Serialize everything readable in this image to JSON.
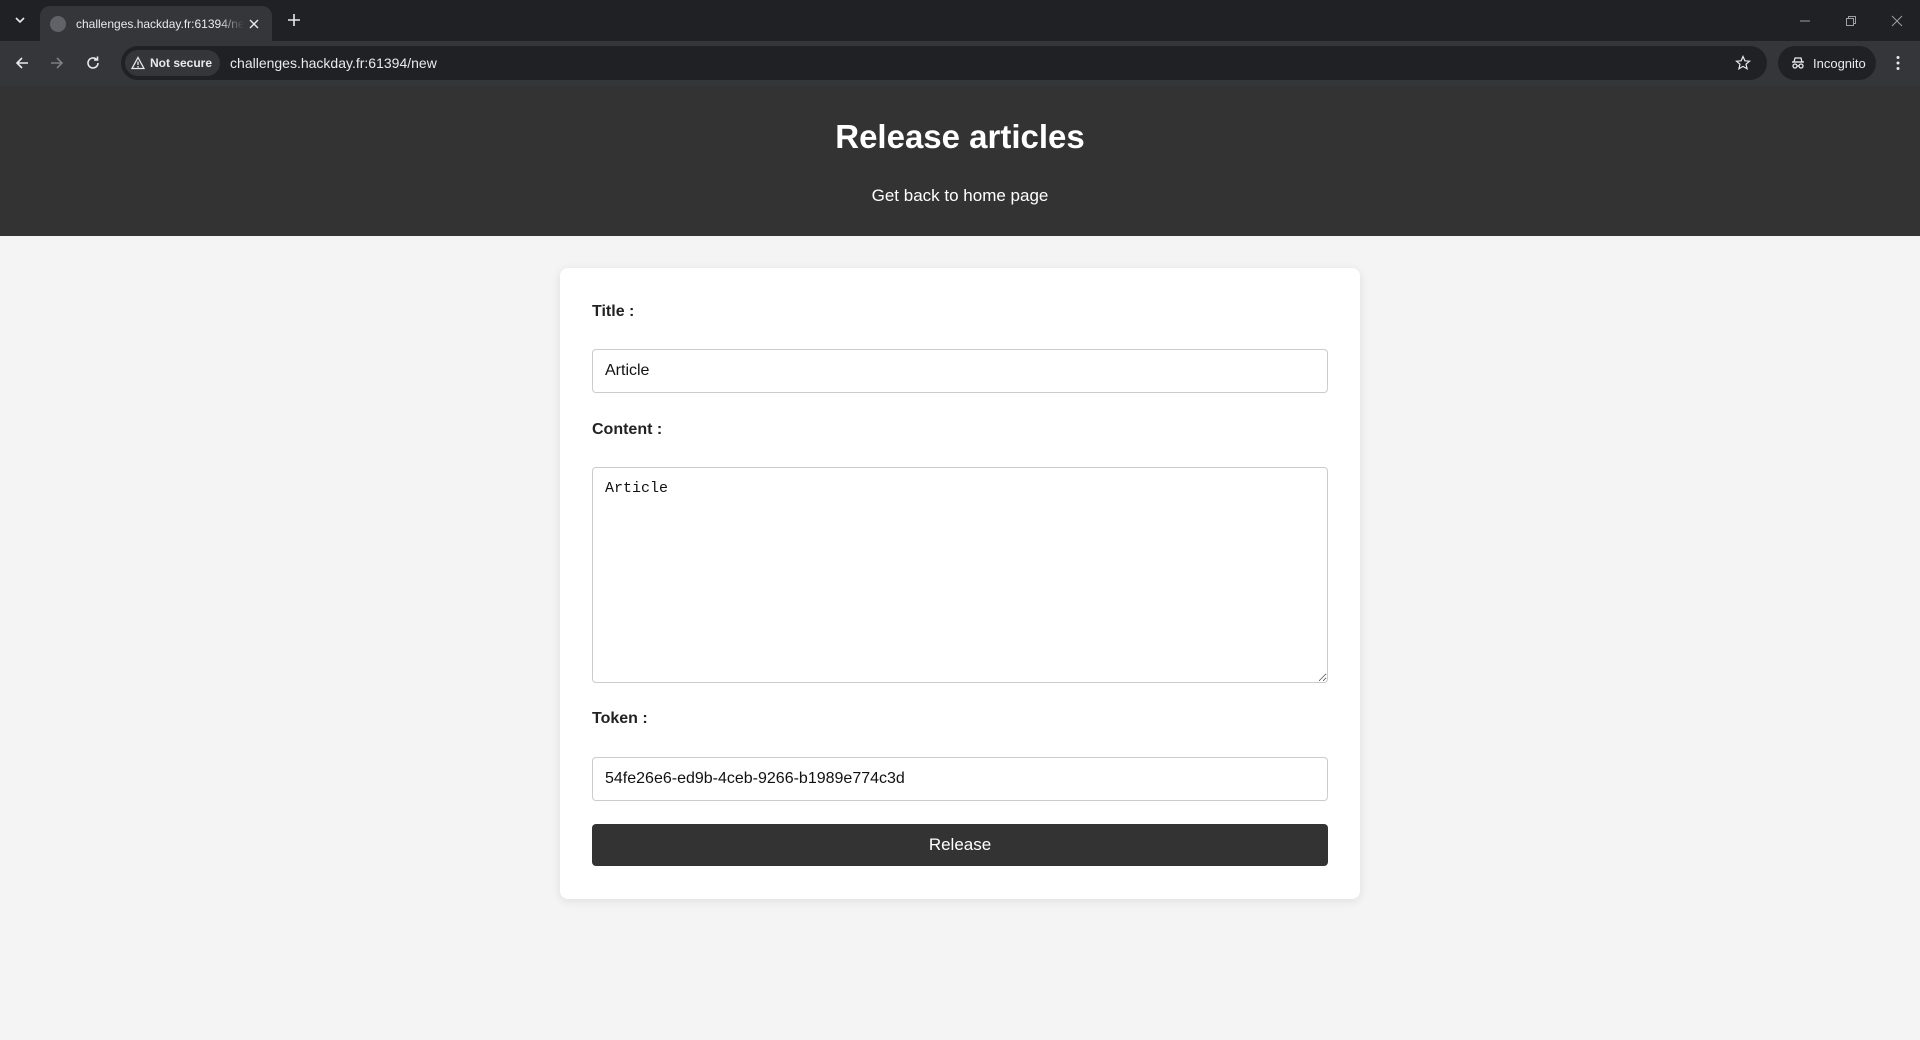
{
  "browser": {
    "tab_title": "challenges.hackday.fr:61394/new",
    "security_label": "Not secure",
    "url_host": "challenges.hackday.fr",
    "url_rest": ":61394/new",
    "profile_label": "Incognito"
  },
  "header": {
    "title": "Release articles",
    "home_link": "Get back to home page"
  },
  "form": {
    "title_label": "Title :",
    "title_value": "Article",
    "content_label": "Content :",
    "content_value": "Article",
    "token_label": "Token :",
    "token_value": "54fe26e6-ed9b-4ceb-9266-b1989e774c3d",
    "submit_label": "Release"
  }
}
